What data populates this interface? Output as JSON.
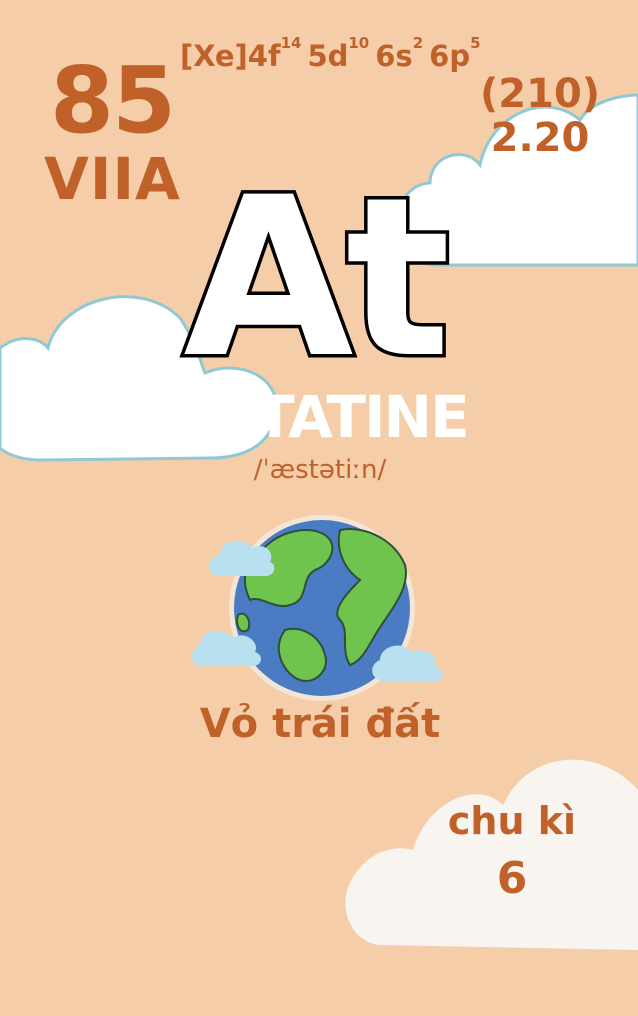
{
  "element": {
    "atomic_number": "85",
    "group": "VIIA",
    "config_core": "[Xe]",
    "config_terms": [
      {
        "orbital": "4f",
        "electrons": "14"
      },
      {
        "orbital": "5d",
        "electrons": "10"
      },
      {
        "orbital": "6s",
        "electrons": "2"
      },
      {
        "orbital": "6p",
        "electrons": "5"
      }
    ],
    "atomic_mass": "(210)",
    "electronegativity": "2.20",
    "symbol": "At",
    "name": "ASTATINE",
    "pronunciation": "/ˈæstətiːn/",
    "occurrence": "Vỏ trái đất",
    "period_label": "chu kì",
    "period_value": "6"
  },
  "colors": {
    "background": "#f5cda8",
    "accent_brown": "#c0612a",
    "cloud_white": "#ffffff",
    "cloud_outline": "#8fc9d6",
    "earth_ocean": "#4a7cc4",
    "earth_land": "#6fc44e",
    "small_cloud": "#b9e0ee"
  },
  "icons": [
    "cloud-icon",
    "earth-globe-icon"
  ]
}
